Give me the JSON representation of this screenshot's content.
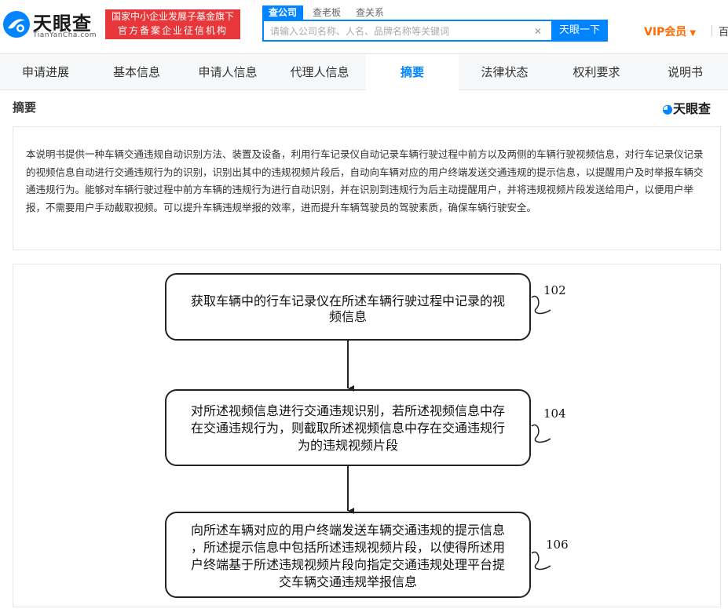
{
  "header": {
    "logo_text": "天眼查",
    "logo_sub": "TianYanCha.com",
    "banner_line1": "国家中小企业发展子基金旗下",
    "banner_line2": "官方备案企业征信机构",
    "search_tabs": [
      "查公司",
      "查老板",
      "查关系"
    ],
    "search_placeholder": "请输入公司名称、人名、品牌名称等关键词",
    "search_button": "天眼一下",
    "vip_label": "VIP会员",
    "more_label": "百"
  },
  "nav": {
    "items": [
      "申请进展",
      "基本信息",
      "申请人信息",
      "代理人信息",
      "摘要",
      "法律状态",
      "权利要求",
      "说明书"
    ],
    "active": "摘要"
  },
  "section": {
    "title": "摘要",
    "brand": "天眼查"
  },
  "abstract": {
    "text": "本说明书提供一种车辆交通违规自动识别方法、装置及设备，利用行车记录仪自动记录车辆行驶过程中前方以及两侧的车辆行驶视频信息，对行车记录仪记录的视频信息自动进行交通违规行为的识别，识别出其中的违规视频片段后，自动向车辆对应的用户终端发送交通违规的提示信息，以提醒用户及时举报车辆交通违规行为。能够对车辆行驶过程中前方车辆的违规行为进行自动识别，并在识别到违规行为后主动提醒用户，并将违规视频片段发送给用户，以便用户举报，不需要用户手动截取视频。可以提升车辆违规举报的效率，进而提升车辆驾驶员的驾驶素质，确保车辆行驶安全。"
  },
  "figure": {
    "steps": [
      {
        "number": "102",
        "lines": [
          "获取车辆中的行车记录仪在所述车辆行驶过程中记录的视",
          "频信息"
        ]
      },
      {
        "number": "104",
        "lines": [
          "对所述视频信息进行交通违规识别，若所述视频信息中存",
          "在交通违规行为，则截取所述视频信息中存在交通违规行",
          "为的违规视频片段"
        ]
      },
      {
        "number": "106",
        "lines": [
          "向所述车辆对应的用户终端发送车辆交通违规的提示信息",
          "，所述提示信息中包括所述违规视频片段，以使得所述用",
          "户终端基于所述违规视频片段向指定交通违规处理平台提",
          "交车辆交通违规举报信息"
        ]
      }
    ]
  },
  "colors": {
    "accent": "#0084ff",
    "banner": "#e8373b",
    "vip": "#ff6a00"
  }
}
